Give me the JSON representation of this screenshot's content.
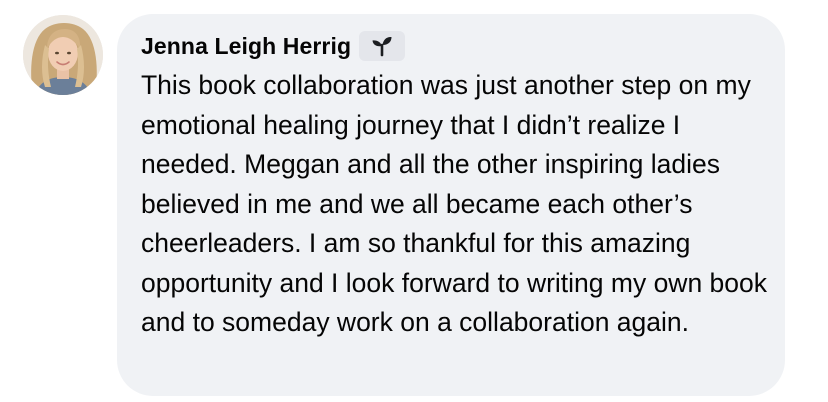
{
  "comment": {
    "author": "Jenna Leigh Herrig",
    "badge_icon": "new-member-sprout-icon",
    "text": "This book collaboration was just another step on my emotional healing journey that I didn’t realize I needed. Meggan and all the other inspiring ladies believed in me and we all became each other’s cheerleaders. I am so thankful for this amazing opportunity and I look forward to writing my own book and to someday work on a collaboration again."
  },
  "colors": {
    "bubble_background": "#f0f2f5",
    "badge_background": "#e4e6eb",
    "text": "#050505"
  }
}
